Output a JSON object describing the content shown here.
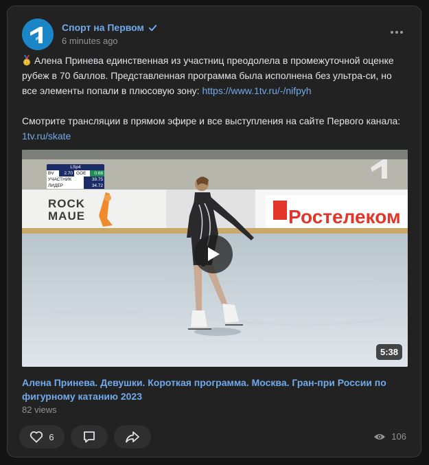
{
  "post": {
    "author": "Спорт на Первом",
    "time": "6 minutes ago",
    "text_p1": "Алена Принева единственная из участниц преодолела в промежуточной оценке рубеж в 70 баллов. Представленная программа была исполнена без ультра-си, но все элементы попали в плюсовую зону: ",
    "link1": "https://www.1tv.ru/-/nifpyh",
    "text_p2": "Смотрите трансляции в прямом эфире и все выступления на сайте Первого канала: ",
    "link2": "1tv.ru/skate"
  },
  "video": {
    "duration": "5:38",
    "title": "Алена Принева. Девушки. Короткая программа. Москва. Гран-при России по фигурному катанию 2023",
    "views": "82 views",
    "score_overlay": {
      "element": "LSp4",
      "bv_label": "BV",
      "bv": "2.70",
      "goe_label": "GOE",
      "goe": "0.68",
      "row1_label": "УЧАСТНИК",
      "row1_value": "39.75",
      "row2_label": "ЛИДЕР",
      "row2_value": "34.72"
    },
    "banner_left": "ROCK MAUE",
    "banner_right": "Ростелеком"
  },
  "actions": {
    "likes": "6",
    "views": "106"
  },
  "colors": {
    "accent": "#71aaeb",
    "card": "#222222",
    "background": "#141414"
  }
}
